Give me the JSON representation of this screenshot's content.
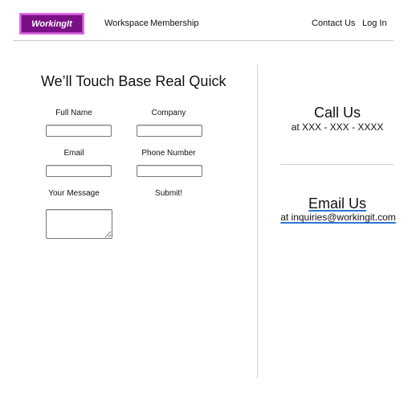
{
  "header": {
    "logo_text": "WorkingIt",
    "nav_left": [
      "Workspace",
      "Membership"
    ],
    "nav_right": [
      "Contact Us",
      "Log In"
    ],
    "brand_color": "#7a0f86"
  },
  "form": {
    "title": "We’ll Touch Base Real Quick",
    "full_name_label": "Full Name",
    "company_label": "Company",
    "email_label": "Email",
    "phone_label": "Phone Number",
    "message_label": "Your Message",
    "submit_label": "Submit!",
    "full_name_value": "",
    "company_value": "",
    "email_value": "",
    "phone_value": "",
    "message_value": ""
  },
  "contact": {
    "call_heading": "Call Us",
    "call_detail": "at XXX - XXX - XXXX",
    "email_heading": "Email Us",
    "email_detail": "at inquiries@workingit.com",
    "link_color": "#2b78d4"
  }
}
